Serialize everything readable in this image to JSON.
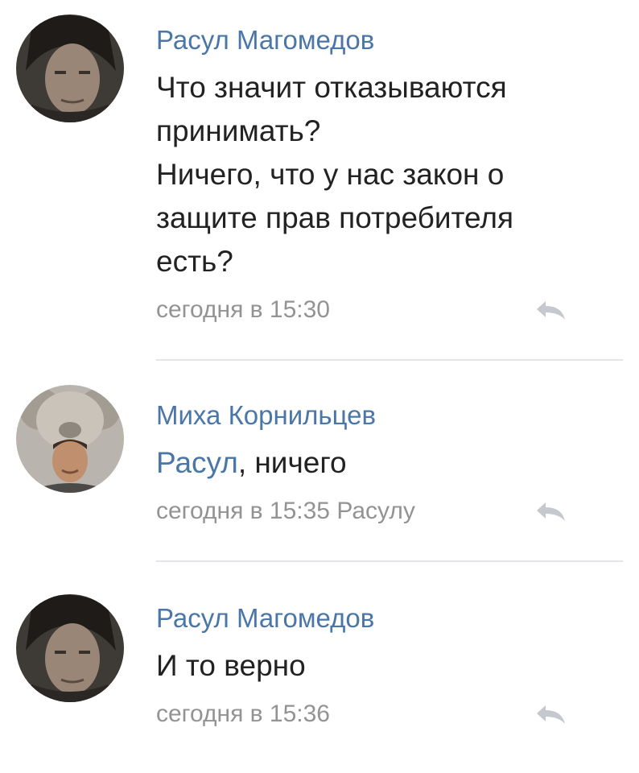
{
  "comments": [
    {
      "author": "Расул Магомедов",
      "lines": [
        "Что значит отказываются",
        "принимать?",
        "Ничего, что у нас закон о",
        "защите прав потребителя",
        "есть?"
      ],
      "time": "сегодня в 15:30",
      "reply_icon": "reply-arrow-icon"
    },
    {
      "author": "Миха Корнильцев",
      "mention": "Расул",
      "text_rest": ", ничего",
      "time": "сегодня в 15:35",
      "reply_to": "Расулу",
      "reply_icon": "reply-arrow-icon"
    },
    {
      "author": "Расул Магомедов",
      "lines": [
        "И то верно"
      ],
      "time": "сегодня в 15:36",
      "reply_icon": "reply-arrow-icon"
    }
  ],
  "colors": {
    "link": "#4a76a8",
    "text": "#222222",
    "meta": "#939393",
    "divider": "#e3e4e8"
  }
}
